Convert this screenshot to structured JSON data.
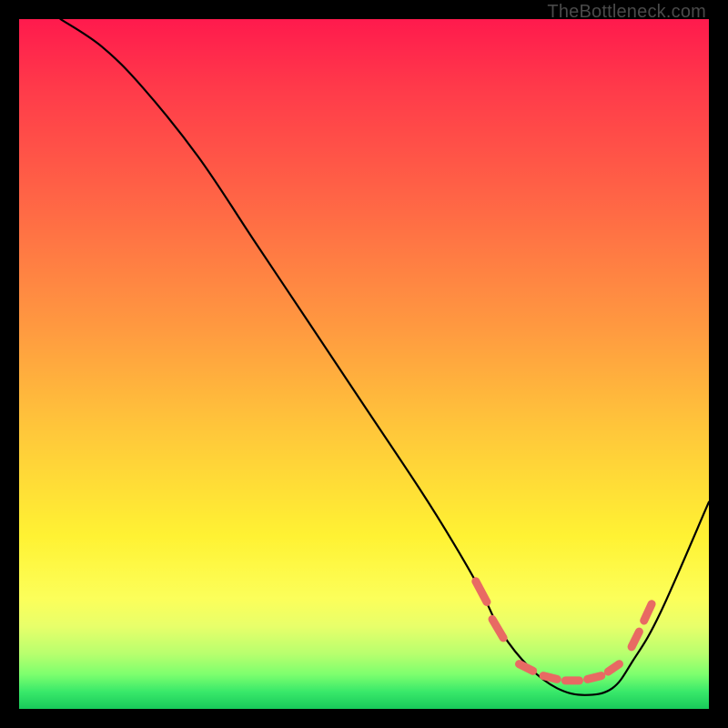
{
  "watermark": "TheBottleneck.com",
  "colors": {
    "background": "#000000",
    "curve": "#000000",
    "marker": "#e86a63",
    "gradient_stops": [
      "#ff1a4d",
      "#ff3a4a",
      "#ff6a45",
      "#ff9a40",
      "#ffc83a",
      "#fff233",
      "#fcff5a",
      "#e8ff6a",
      "#b8ff6e",
      "#7dff6e",
      "#39e96a",
      "#18c95a"
    ]
  },
  "chart_data": {
    "type": "line",
    "title": "",
    "xlabel": "",
    "ylabel": "",
    "xlim": [
      0,
      100
    ],
    "ylim": [
      0,
      100
    ],
    "note": "x and y normalized to 0-100 across the gradient square. y=0 is bottom edge (green), y=100 is top edge (red). The plotted curve is the black V-shaped line; markers are the salmon dash segments near the valley.",
    "series": [
      {
        "name": "bottleneck-curve",
        "x": [
          6,
          12,
          18,
          26,
          34,
          42,
          50,
          58,
          63,
          67,
          70,
          74,
          78,
          82,
          86,
          89,
          93,
          100
        ],
        "y": [
          100,
          96,
          90,
          80,
          68,
          56,
          44,
          32,
          24,
          17,
          11,
          6,
          3,
          2,
          3,
          7,
          14,
          30
        ]
      }
    ],
    "markers": {
      "name": "highlight-dashes",
      "segments": [
        {
          "x0": 66.2,
          "y0": 18.5,
          "x1": 67.8,
          "y1": 15.5
        },
        {
          "x0": 68.6,
          "y0": 13.0,
          "x1": 70.2,
          "y1": 10.3
        },
        {
          "x0": 72.5,
          "y0": 6.5,
          "x1": 74.5,
          "y1": 5.5
        },
        {
          "x0": 76.0,
          "y0": 4.8,
          "x1": 78.0,
          "y1": 4.3
        },
        {
          "x0": 79.2,
          "y0": 4.1,
          "x1": 81.2,
          "y1": 4.1
        },
        {
          "x0": 82.4,
          "y0": 4.3,
          "x1": 84.4,
          "y1": 4.8
        },
        {
          "x0": 85.4,
          "y0": 5.4,
          "x1": 87.0,
          "y1": 6.5
        },
        {
          "x0": 88.8,
          "y0": 9.0,
          "x1": 89.9,
          "y1": 11.2
        },
        {
          "x0": 90.6,
          "y0": 12.8,
          "x1": 91.7,
          "y1": 15.2
        }
      ]
    }
  }
}
